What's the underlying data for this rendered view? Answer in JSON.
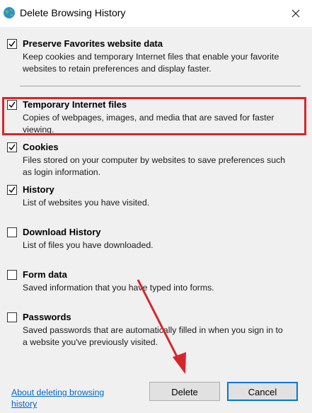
{
  "window": {
    "title": "Delete Browsing History",
    "icon": "internet-explorer-globe-icon"
  },
  "options": [
    {
      "id": "preserve-favorites",
      "title": "Preserve Favorites website data",
      "description": "Keep cookies and temporary Internet files that enable your favorite websites to retain preferences and display faster.",
      "checked": true
    },
    {
      "id": "temporary-internet-files",
      "title": "Temporary Internet files",
      "description": "Copies of webpages, images, and media that are saved for faster viewing.",
      "checked": true
    },
    {
      "id": "cookies",
      "title": "Cookies",
      "description": "Files stored on your computer by websites to save preferences such as login information.",
      "checked": true
    },
    {
      "id": "history",
      "title": "History",
      "description": "List of websites you have visited.",
      "checked": true
    },
    {
      "id": "download-history",
      "title": "Download History",
      "description": "List of files you have downloaded.",
      "checked": false
    },
    {
      "id": "form-data",
      "title": "Form data",
      "description": "Saved information that you have typed into forms.",
      "checked": false
    },
    {
      "id": "passwords",
      "title": "Passwords",
      "description": "Saved passwords that are automatically filled in when you sign in to a website you've previously visited.",
      "checked": false
    }
  ],
  "footer": {
    "about_link": "About deleting browsing history",
    "delete_label": "Delete",
    "cancel_label": "Cancel"
  },
  "annotation": {
    "highlight_color": "#d7262b",
    "arrow_color": "#d7262b"
  }
}
